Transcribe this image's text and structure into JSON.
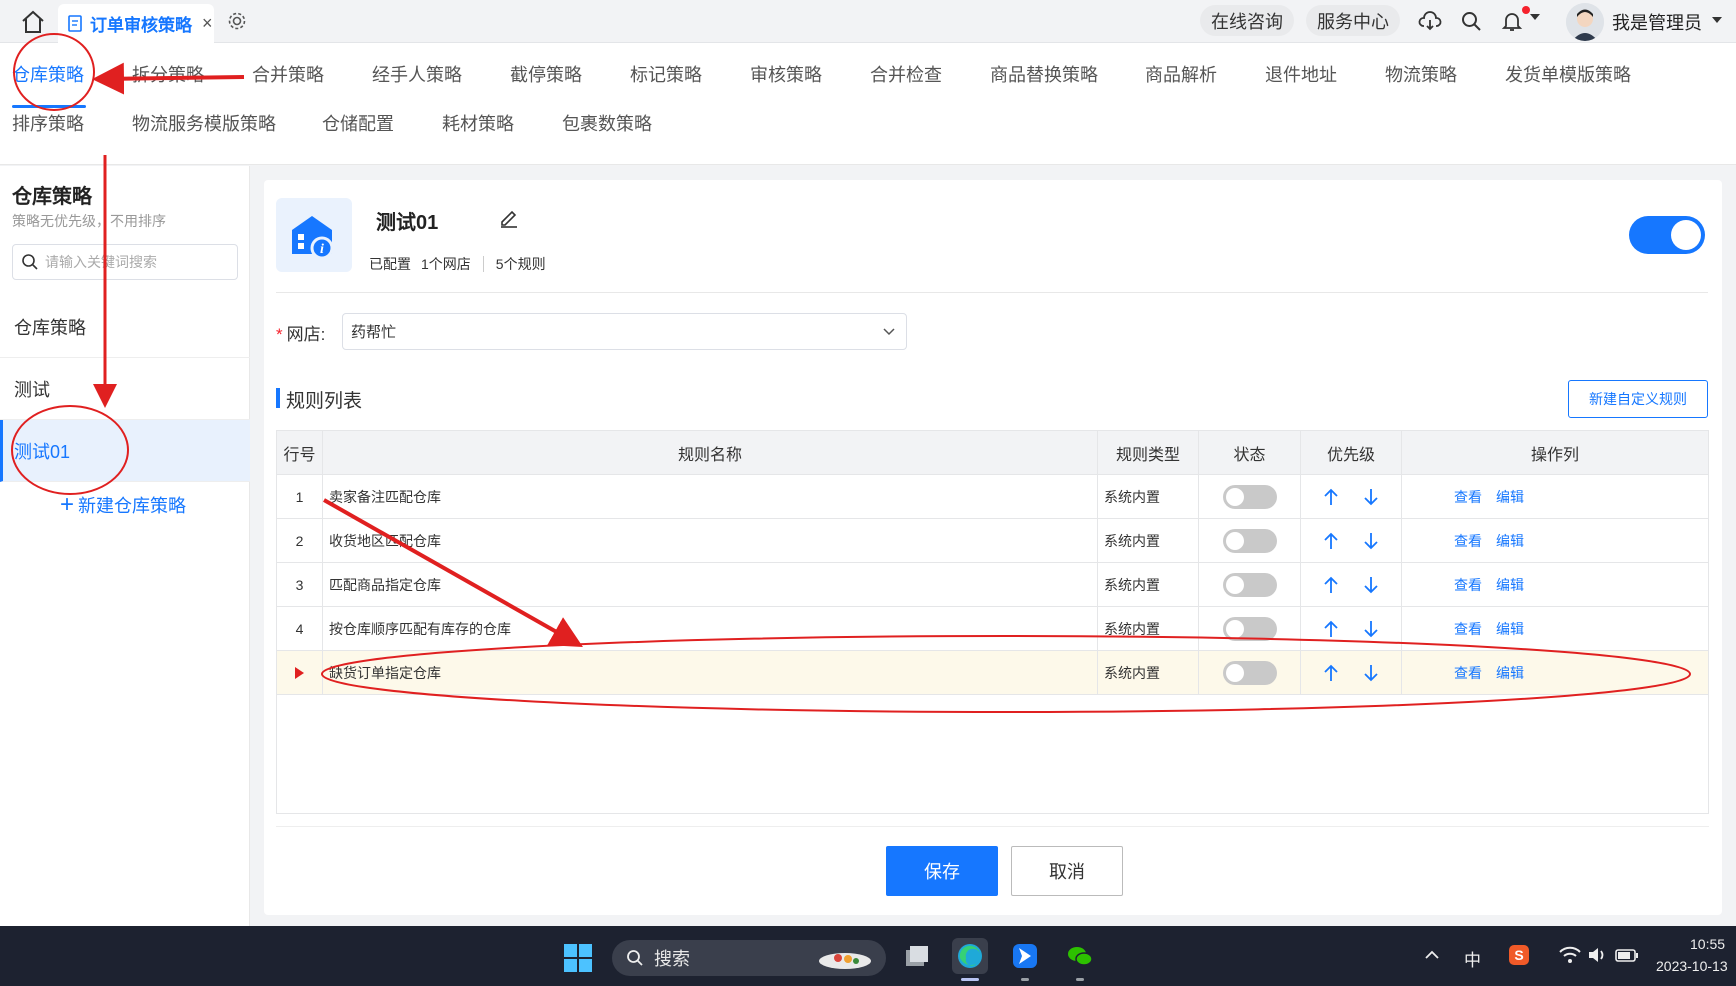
{
  "window": {
    "tab_title": "订单审核策略",
    "tab_close": "×"
  },
  "header": {
    "consult": "在线咨询",
    "service_center": "服务中心",
    "user_name": "我是管理员"
  },
  "strategy_tabs": [
    {
      "label": "仓库策略",
      "active": true
    },
    {
      "label": "拆分策略"
    },
    {
      "label": "合并策略"
    },
    {
      "label": "经手人策略"
    },
    {
      "label": "截停策略"
    },
    {
      "label": "标记策略"
    },
    {
      "label": "审核策略"
    },
    {
      "label": "合并检查"
    },
    {
      "label": "商品替换策略"
    },
    {
      "label": "商品解析"
    },
    {
      "label": "退件地址"
    },
    {
      "label": "物流策略"
    },
    {
      "label": "发货单模版策略"
    },
    {
      "label": "排序策略"
    },
    {
      "label": "物流服务模版策略"
    },
    {
      "label": "仓储配置"
    },
    {
      "label": "耗材策略"
    },
    {
      "label": "包裹数策略"
    }
  ],
  "left_panel": {
    "title": "仓库策略",
    "subtitle": "策略无优先级，不用排序",
    "search_placeholder": "请输入关键词搜索",
    "items": [
      {
        "label": "仓库策略"
      },
      {
        "label": "测试"
      },
      {
        "label": "测试01",
        "active": true
      }
    ],
    "new_label": "新建仓库策略"
  },
  "strategy": {
    "name": "测试01",
    "status": "已配置",
    "shops": "1个网店",
    "rules": "5个规则",
    "enabled": true
  },
  "form": {
    "shop_label": "网店:",
    "required_mark": "*",
    "shop_value": "药帮忙"
  },
  "rules_section": {
    "title": "规则列表",
    "new_button": "新建自定义规则",
    "columns": [
      "行号",
      "规则名称",
      "规则类型",
      "状态",
      "优先级",
      "操作列"
    ],
    "rows": [
      {
        "no": "1",
        "name": "卖家备注匹配仓库",
        "type": "系统内置",
        "enabled": false,
        "view": "查看",
        "edit": "编辑"
      },
      {
        "no": "2",
        "name": "收货地区匹配仓库",
        "type": "系统内置",
        "enabled": false,
        "view": "查看",
        "edit": "编辑"
      },
      {
        "no": "3",
        "name": "匹配商品指定仓库",
        "type": "系统内置",
        "enabled": false,
        "view": "查看",
        "edit": "编辑"
      },
      {
        "no": "4",
        "name": "按仓库顺序匹配有库存的仓库",
        "type": "系统内置",
        "enabled": false,
        "view": "查看",
        "edit": "编辑"
      },
      {
        "no": "",
        "name": "缺货订单指定仓库",
        "type": "系统内置",
        "enabled": false,
        "view": "查看",
        "edit": "编辑",
        "highlighted": true
      }
    ]
  },
  "actions": {
    "save": "保存",
    "cancel": "取消"
  },
  "taskbar": {
    "search_label": "搜索",
    "ime": "中",
    "time": "10:55",
    "date": "2023-10-13"
  },
  "colors": {
    "accent": "#1677ff",
    "annotation": "#e02020",
    "highlight_row": "#fdf9ea"
  }
}
